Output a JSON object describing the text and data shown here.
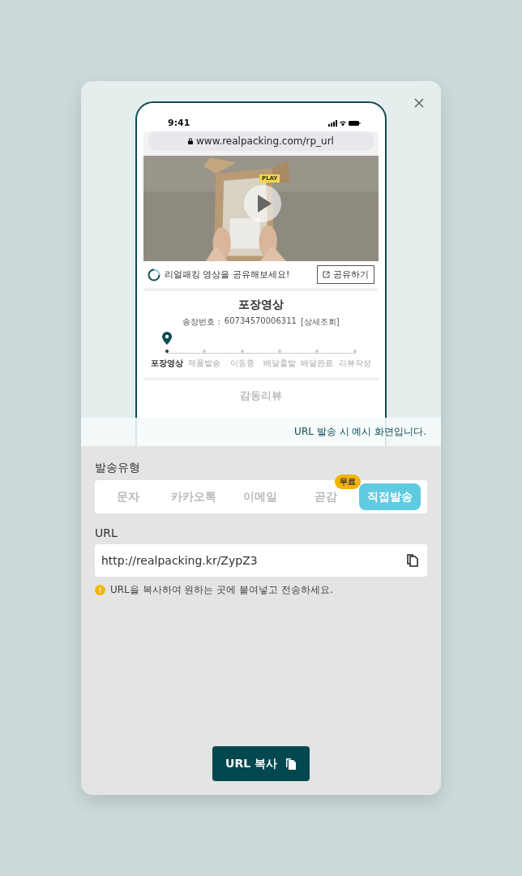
{
  "preview": {
    "status_time": "9:41",
    "address": "www.realpacking.com/rp_url",
    "video_tag": "PLAY",
    "share_text": "리얼패킹 영상을 공유해보세요!",
    "share_button": "공유하기",
    "card_title": "포장영상",
    "tracking_label": "송장번호 :",
    "tracking_number": "60734570006311",
    "detail_link": "[상세조회]",
    "steps": [
      {
        "label": "포장영상",
        "selected": true
      },
      {
        "label": "제품발송",
        "selected": false
      },
      {
        "label": "이동중",
        "selected": false
      },
      {
        "label": "배달출발",
        "selected": false
      },
      {
        "label": "배달완료",
        "selected": false
      },
      {
        "label": "리뷰작성",
        "selected": false
      }
    ],
    "next_section": "감동리뷰",
    "caption": "URL 발송 시 예시 화면입니다."
  },
  "send_type_label": "발송유형",
  "send_types": [
    {
      "label": "문자",
      "selected": false
    },
    {
      "label": "카카오톡",
      "selected": false
    },
    {
      "label": "이메일",
      "selected": false
    },
    {
      "label": "곧감",
      "selected": false,
      "badge": "무료"
    },
    {
      "label": "직접발송",
      "selected": true
    }
  ],
  "url_label": "URL",
  "url_value": "http://realpacking.kr/ZypZ3",
  "notice": "URL을 복사하여 원하는 곳에 붙여넣고 전송하세요.",
  "copy_button": "URL 복사"
}
